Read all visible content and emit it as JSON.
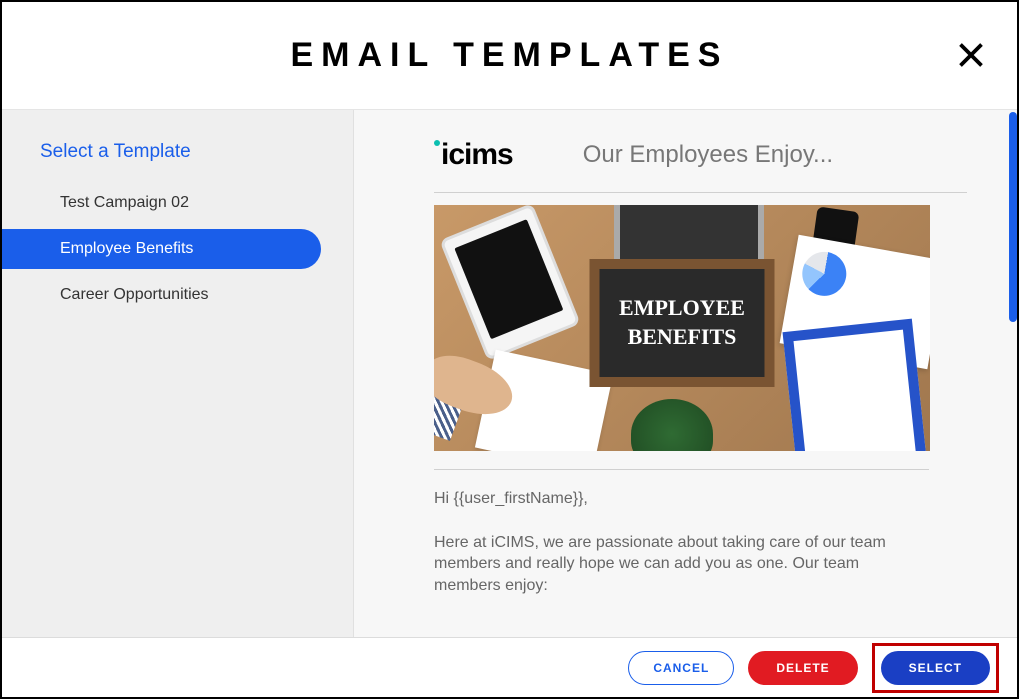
{
  "header": {
    "title": "EMAIL TEMPLATES"
  },
  "sidebar": {
    "heading": "Select a Template",
    "items": [
      {
        "label": "Test Campaign 02",
        "active": false
      },
      {
        "label": "Employee Benefits",
        "active": true
      },
      {
        "label": "Career Opportunities",
        "active": false
      }
    ]
  },
  "preview": {
    "logo_text": "icims",
    "subject": "Our Employees Enjoy...",
    "hero_line1": "EMPLOYEE",
    "hero_line2": "BENEFITS",
    "greeting": "Hi {{user_firstName}},",
    "paragraph1": "Here at iCIMS, we are passionate about taking care of our team members and really hope we can add you as one.  Our team members enjoy:"
  },
  "footer": {
    "cancel_label": "CANCEL",
    "delete_label": "DELETE",
    "select_label": "SELECT"
  }
}
